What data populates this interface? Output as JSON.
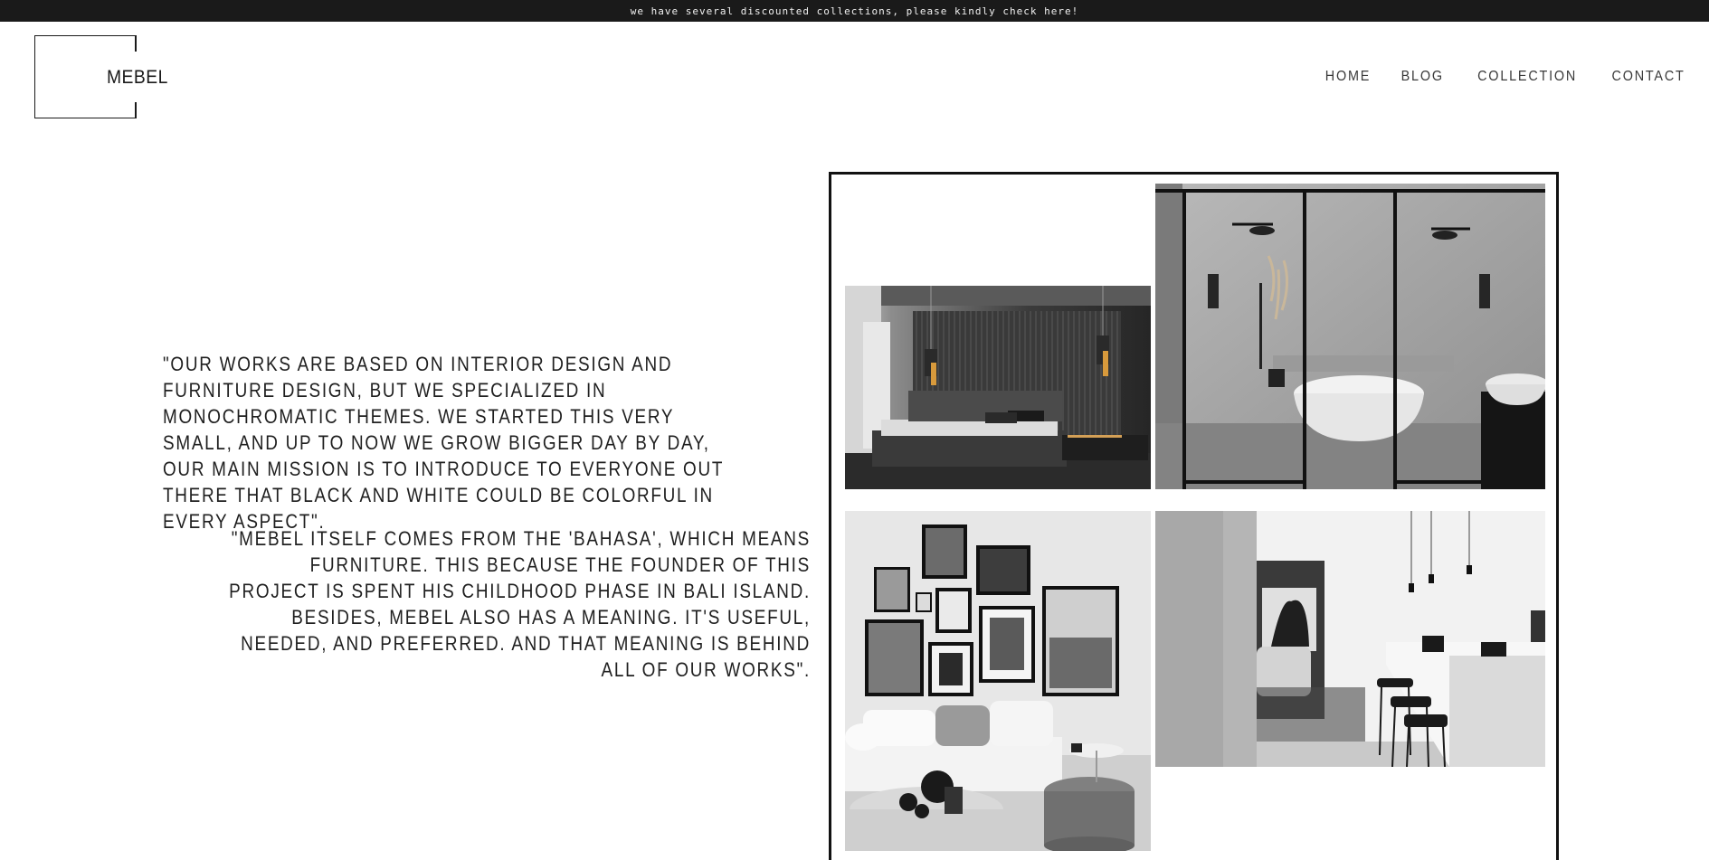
{
  "announcement": "we have several discounted collections, please kindly check here!",
  "logo": {
    "text": "MEBEL"
  },
  "nav": [
    "HOME",
    "BLOG",
    "COLLECTION",
    "CONTACT"
  ],
  "about": {
    "paragraph_1": "\"OUR WORKS ARE BASED ON INTERIOR DESIGN AND FURNITURE DESIGN, BUT WE SPECIALIZED IN MONOCHROMATIC THEMES. WE STARTED THIS VERY SMALL, AND UP TO NOW WE GROW BIGGER DAY BY DAY, OUR MAIN MISSION IS TO INTRODUCE TO EVERYONE OUT THERE THAT BLACK AND WHITE COULD BE COLORFUL IN EVERY ASPECT\".",
    "paragraph_2": "\"MEBEL ITSELF COMES FROM THE 'BAHASA', WHICH MEANS FURNITURE. THIS BECAUSE THE FOUNDER OF THIS PROJECT IS SPENT HIS CHILDHOOD PHASE IN BALI ISLAND. BESIDES, MEBEL ALSO HAS A MEANING. IT'S USEFUL, NEEDED, AND PREFERRED. AND THAT MEANING IS BEHIND ALL OF OUR WORKS\"."
  },
  "colors": {
    "topbar": "#1a1a1a",
    "text": "#1f1f1f",
    "background": "#ffffff"
  }
}
